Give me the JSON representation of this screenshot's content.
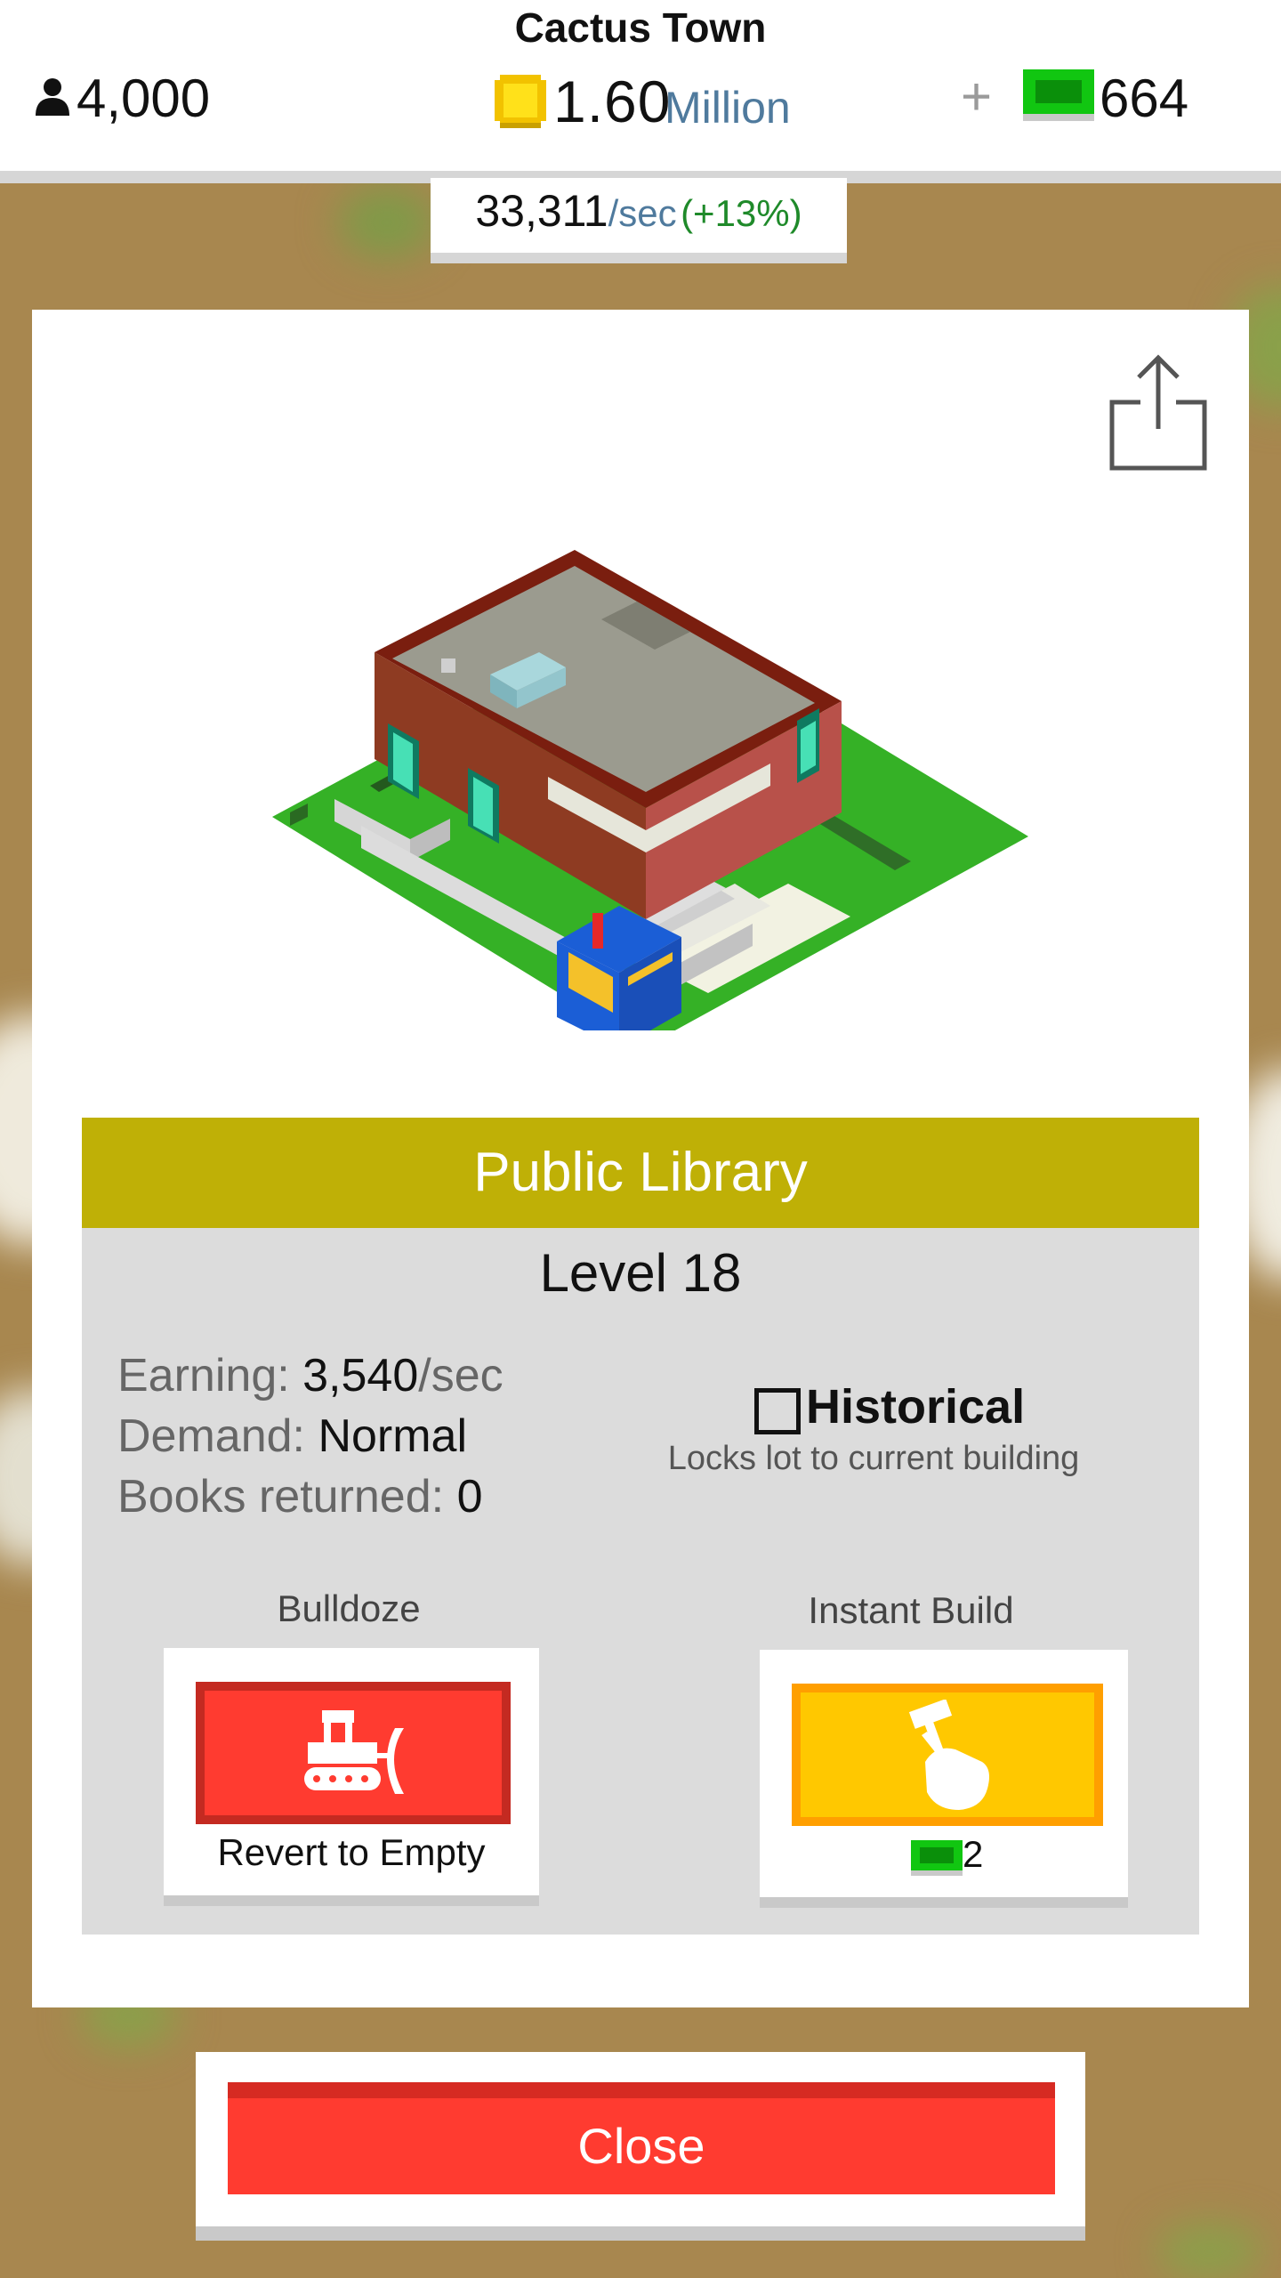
{
  "header": {
    "town_name": "Cactus Town",
    "population": "4,000",
    "money_value": "1.60",
    "money_unit": "Million",
    "plus_label": "+",
    "cash": "664",
    "rate_value": "33,311",
    "rate_unit": "/sec",
    "rate_bonus": "(+13%)"
  },
  "building": {
    "name": "Public Library",
    "level": "Level 18",
    "stats": {
      "earning_key": "Earning:",
      "earning_value": "3,540",
      "earning_unit": "/sec",
      "demand_key": "Demand:",
      "demand_value": "Normal",
      "books_key": "Books returned:",
      "books_value": "0"
    },
    "historical": {
      "label": "Historical",
      "description": "Locks lot to current building",
      "checked": false
    }
  },
  "actions": {
    "bulldoze_label": "Bulldoze",
    "revert_label": "Revert to Empty",
    "instant_label": "Instant Build",
    "instant_cost": "2"
  },
  "close_label": "Close",
  "colors": {
    "title_bar": "#bfb006",
    "bulldoze": "#ff3b30",
    "instant": "#ffc800",
    "cash_green": "#11c611",
    "background": "#a8874f"
  },
  "icons": [
    "person-icon",
    "coin-icon",
    "cash-icon",
    "share-icon",
    "bulldozer-icon",
    "hammer-hand-icon"
  ]
}
